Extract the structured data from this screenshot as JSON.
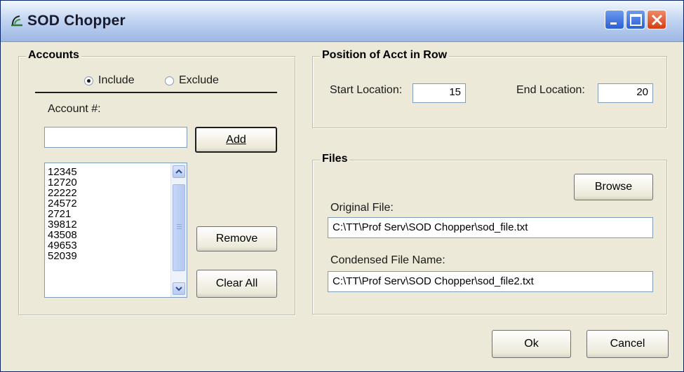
{
  "window": {
    "title": "SOD Chopper",
    "icon": "sod-chopper-app-icon",
    "controls": [
      "minimize-icon",
      "maximize-icon",
      "close-icon"
    ]
  },
  "accounts": {
    "group_title": "Accounts",
    "include_label": "Include",
    "exclude_label": "Exclude",
    "selected_mode": "Include",
    "account_label": "Account #:",
    "account_input_value": "",
    "add_button": "Add",
    "list_items": [
      "12345",
      "12720",
      "22222",
      "24572",
      "2721",
      "39812",
      "43508",
      "49653",
      "52039"
    ],
    "remove_button": "Remove",
    "clear_all_button": "Clear All"
  },
  "position": {
    "group_title": "Position of Acct in Row",
    "start_label": "Start Location:",
    "start_value": "15",
    "end_label": "End Location:",
    "end_value": "20"
  },
  "files": {
    "group_title": "Files",
    "browse_button": "Browse",
    "original_label": "Original File:",
    "original_value": "C:\\TT\\Prof Serv\\SOD Chopper\\sod_file.txt",
    "condensed_label": "Condensed File Name:",
    "condensed_value": "C:\\TT\\Prof Serv\\SOD Chopper\\sod_file2.txt"
  },
  "footer": {
    "ok_button": "Ok",
    "cancel_button": "Cancel"
  },
  "colors": {
    "titlebar_top": "#f2f7ff",
    "titlebar_bottom": "#9db7e4",
    "dialog_bg": "#ece9d8",
    "close_red": "#d43c14",
    "control_blue": "#2a5fd6"
  }
}
